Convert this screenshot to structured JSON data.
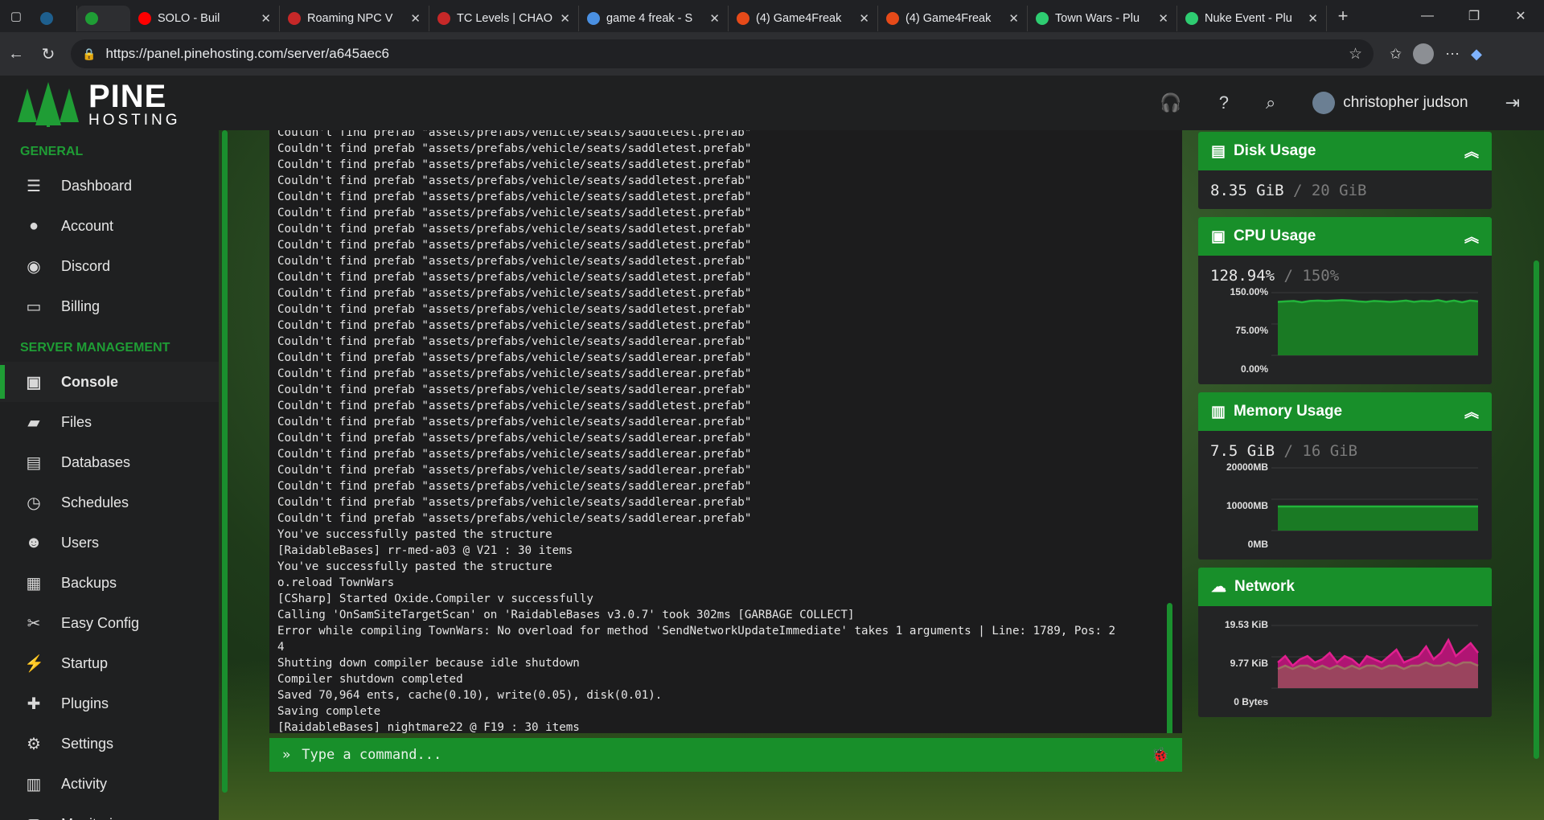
{
  "browser": {
    "tabs": [
      {
        "title": "",
        "favicon_color": "#1e5f8e"
      },
      {
        "title": "",
        "favicon_color": "#1f9d35",
        "active": true
      },
      {
        "title": "SOLO - Buil",
        "favicon_color": "#ff0000"
      },
      {
        "title": "Roaming NPC V",
        "favicon_color": "#c62828"
      },
      {
        "title": "TC Levels | CHAO",
        "favicon_color": "#c62828"
      },
      {
        "title": "game 4 freak - S",
        "favicon_color": "#4a90e2"
      },
      {
        "title": "(4) Game4Freak",
        "favicon_color": "#e64a19"
      },
      {
        "title": "(4) Game4Freak",
        "favicon_color": "#e64a19"
      },
      {
        "title": "Town Wars - Plu",
        "favicon_color": "#2ecc71"
      },
      {
        "title": "Nuke Event - Plu",
        "favicon_color": "#2ecc71"
      }
    ],
    "url": "https://panel.pinehosting.com/server/a645aec6"
  },
  "header": {
    "logo_big": "PINE",
    "logo_small": "HOSTING",
    "user_name": "christopher judson"
  },
  "sidebar": {
    "section_general": "GENERAL",
    "general_items": [
      {
        "label": "Dashboard",
        "icon": "dashboard-icon"
      },
      {
        "label": "Account",
        "icon": "account-icon"
      },
      {
        "label": "Discord",
        "icon": "discord-icon"
      },
      {
        "label": "Billing",
        "icon": "billing-icon"
      }
    ],
    "section_server": "SERVER MANAGEMENT",
    "server_items": [
      {
        "label": "Console",
        "icon": "terminal-icon"
      },
      {
        "label": "Files",
        "icon": "folder-icon"
      },
      {
        "label": "Databases",
        "icon": "database-icon"
      },
      {
        "label": "Schedules",
        "icon": "clock-icon"
      },
      {
        "label": "Users",
        "icon": "users-icon"
      },
      {
        "label": "Backups",
        "icon": "archive-icon"
      },
      {
        "label": "Easy Config",
        "icon": "wrench-icon"
      },
      {
        "label": "Startup",
        "icon": "bolt-icon"
      },
      {
        "label": "Plugins",
        "icon": "puzzle-icon"
      },
      {
        "label": "Settings",
        "icon": "gear-icon"
      },
      {
        "label": "Activity",
        "icon": "activity-icon"
      },
      {
        "label": "Monitoring",
        "icon": "monitor-icon"
      }
    ]
  },
  "console": {
    "lines": [
      "Couldn't find prefab \"assets/prefabs/vehicle/seats/saddletest.prefab\"",
      "Couldn't find prefab \"assets/prefabs/vehicle/seats/saddletest.prefab\"",
      "Couldn't find prefab \"assets/prefabs/vehicle/seats/saddletest.prefab\"",
      "Couldn't find prefab \"assets/prefabs/vehicle/seats/saddletest.prefab\"",
      "Couldn't find prefab \"assets/prefabs/vehicle/seats/saddletest.prefab\"",
      "Couldn't find prefab \"assets/prefabs/vehicle/seats/saddletest.prefab\"",
      "Couldn't find prefab \"assets/prefabs/vehicle/seats/saddletest.prefab\"",
      "Couldn't find prefab \"assets/prefabs/vehicle/seats/saddletest.prefab\"",
      "Couldn't find prefab \"assets/prefabs/vehicle/seats/saddletest.prefab\"",
      "Couldn't find prefab \"assets/prefabs/vehicle/seats/saddletest.prefab\"",
      "Couldn't find prefab \"assets/prefabs/vehicle/seats/saddletest.prefab\"",
      "Couldn't find prefab \"assets/prefabs/vehicle/seats/saddletest.prefab\"",
      "Couldn't find prefab \"assets/prefabs/vehicle/seats/saddletest.prefab\"",
      "Couldn't find prefab \"assets/prefabs/vehicle/seats/saddlerear.prefab\"",
      "Couldn't find prefab \"assets/prefabs/vehicle/seats/saddlerear.prefab\"",
      "Couldn't find prefab \"assets/prefabs/vehicle/seats/saddlerear.prefab\"",
      "Couldn't find prefab \"assets/prefabs/vehicle/seats/saddlerear.prefab\"",
      "Couldn't find prefab \"assets/prefabs/vehicle/seats/saddletest.prefab\"",
      "Couldn't find prefab \"assets/prefabs/vehicle/seats/saddlerear.prefab\"",
      "Couldn't find prefab \"assets/prefabs/vehicle/seats/saddlerear.prefab\"",
      "Couldn't find prefab \"assets/prefabs/vehicle/seats/saddlerear.prefab\"",
      "Couldn't find prefab \"assets/prefabs/vehicle/seats/saddlerear.prefab\"",
      "Couldn't find prefab \"assets/prefabs/vehicle/seats/saddlerear.prefab\"",
      "Couldn't find prefab \"assets/prefabs/vehicle/seats/saddlerear.prefab\"",
      "Couldn't find prefab \"assets/prefabs/vehicle/seats/saddlerear.prefab\"",
      "You've successfully pasted the structure",
      "[RaidableBases] rr-med-a03 @ V21 : 30 items",
      "You've successfully pasted the structure",
      "o.reload TownWars",
      "[CSharp] Started Oxide.Compiler v successfully",
      "Calling 'OnSamSiteTargetScan' on 'RaidableBases v3.0.7' took 302ms [GARBAGE COLLECT]",
      "Error while compiling TownWars: No overload for method 'SendNetworkUpdateImmediate' takes 1 arguments | Line: 1789, Pos: 2",
      "4",
      "Shutting down compiler because idle shutdown",
      "Compiler shutdown completed",
      "Saved 70,964 ents, cache(0.10), write(0.05), disk(0.01).",
      "Saving complete",
      "[RaidableBases] nightmare22 @ F19 : 30 items"
    ],
    "input_placeholder": "Type a command..."
  },
  "stats": {
    "disk": {
      "title": "Disk Usage",
      "used": "8.35 GiB",
      "max": "/ 20 GiB"
    },
    "cpu": {
      "title": "CPU Usage",
      "used": "128.94%",
      "max": "/ 150%",
      "ticks": [
        "150.00%",
        "75.00%",
        "0.00%"
      ],
      "series": [
        128,
        129,
        130,
        127,
        130,
        131,
        130,
        131,
        132,
        131,
        129,
        128,
        130,
        129,
        128,
        129,
        131,
        128,
        130,
        129,
        132,
        128,
        131,
        127,
        131,
        129
      ]
    },
    "memory": {
      "title": "Memory Usage",
      "used": "7.5 GiB",
      "max": "/ 16 GiB",
      "ticks": [
        "20000MB",
        "10000MB",
        "0MB"
      ],
      "series": [
        7700,
        7700,
        7700,
        7700,
        7700,
        7700,
        7700,
        7700,
        7700,
        7700,
        7700,
        7700,
        7700,
        7700,
        7700,
        7700,
        7700,
        7700,
        7700,
        7700
      ]
    },
    "network": {
      "title": "Network",
      "ticks": [
        "19.53 KiB",
        "9.77 KiB",
        "0 Bytes"
      ],
      "series_in": [
        8,
        10,
        7,
        9,
        10,
        8,
        9,
        11,
        8,
        10,
        9,
        7,
        10,
        9,
        8,
        10,
        12,
        8,
        9,
        10,
        13,
        9,
        11,
        15,
        10,
        12,
        14,
        11
      ],
      "series_out": [
        6,
        7,
        6,
        7,
        7,
        6,
        7,
        6,
        7,
        6,
        7,
        6,
        7,
        7,
        6,
        7,
        7,
        6,
        7,
        7,
        8,
        7,
        7,
        8,
        7,
        8,
        8,
        7
      ]
    }
  }
}
